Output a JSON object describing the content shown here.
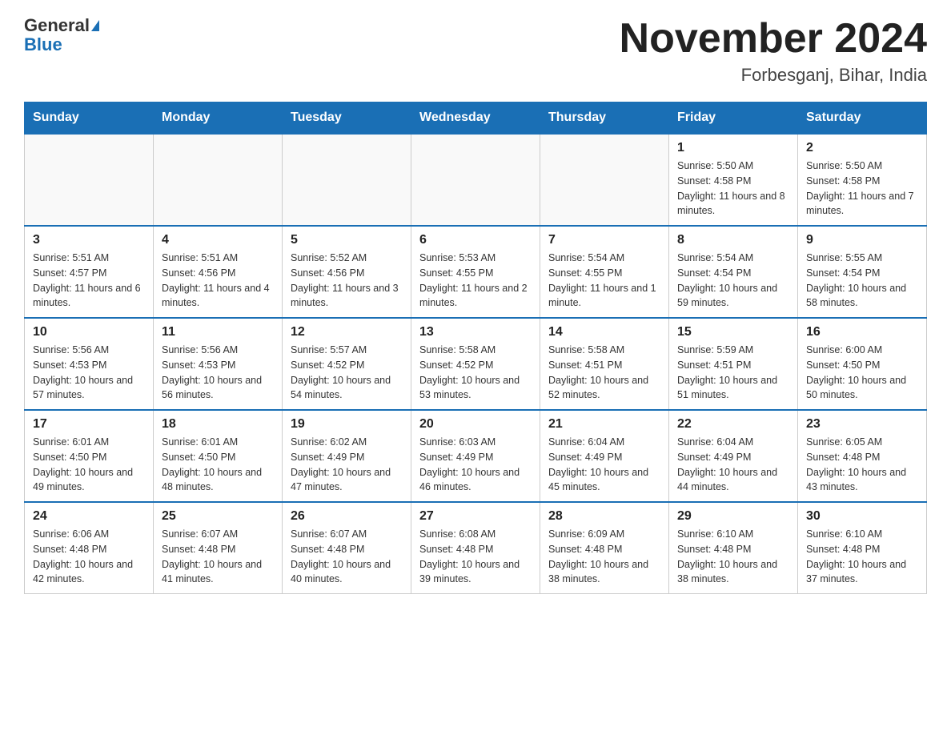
{
  "header": {
    "logo_general": "General",
    "logo_blue": "Blue",
    "month_title": "November 2024",
    "location": "Forbesganj, Bihar, India"
  },
  "days_of_week": [
    "Sunday",
    "Monday",
    "Tuesday",
    "Wednesday",
    "Thursday",
    "Friday",
    "Saturday"
  ],
  "weeks": [
    [
      {
        "day": "",
        "info": ""
      },
      {
        "day": "",
        "info": ""
      },
      {
        "day": "",
        "info": ""
      },
      {
        "day": "",
        "info": ""
      },
      {
        "day": "",
        "info": ""
      },
      {
        "day": "1",
        "info": "Sunrise: 5:50 AM\nSunset: 4:58 PM\nDaylight: 11 hours and 8 minutes."
      },
      {
        "day": "2",
        "info": "Sunrise: 5:50 AM\nSunset: 4:58 PM\nDaylight: 11 hours and 7 minutes."
      }
    ],
    [
      {
        "day": "3",
        "info": "Sunrise: 5:51 AM\nSunset: 4:57 PM\nDaylight: 11 hours and 6 minutes."
      },
      {
        "day": "4",
        "info": "Sunrise: 5:51 AM\nSunset: 4:56 PM\nDaylight: 11 hours and 4 minutes."
      },
      {
        "day": "5",
        "info": "Sunrise: 5:52 AM\nSunset: 4:56 PM\nDaylight: 11 hours and 3 minutes."
      },
      {
        "day": "6",
        "info": "Sunrise: 5:53 AM\nSunset: 4:55 PM\nDaylight: 11 hours and 2 minutes."
      },
      {
        "day": "7",
        "info": "Sunrise: 5:54 AM\nSunset: 4:55 PM\nDaylight: 11 hours and 1 minute."
      },
      {
        "day": "8",
        "info": "Sunrise: 5:54 AM\nSunset: 4:54 PM\nDaylight: 10 hours and 59 minutes."
      },
      {
        "day": "9",
        "info": "Sunrise: 5:55 AM\nSunset: 4:54 PM\nDaylight: 10 hours and 58 minutes."
      }
    ],
    [
      {
        "day": "10",
        "info": "Sunrise: 5:56 AM\nSunset: 4:53 PM\nDaylight: 10 hours and 57 minutes."
      },
      {
        "day": "11",
        "info": "Sunrise: 5:56 AM\nSunset: 4:53 PM\nDaylight: 10 hours and 56 minutes."
      },
      {
        "day": "12",
        "info": "Sunrise: 5:57 AM\nSunset: 4:52 PM\nDaylight: 10 hours and 54 minutes."
      },
      {
        "day": "13",
        "info": "Sunrise: 5:58 AM\nSunset: 4:52 PM\nDaylight: 10 hours and 53 minutes."
      },
      {
        "day": "14",
        "info": "Sunrise: 5:58 AM\nSunset: 4:51 PM\nDaylight: 10 hours and 52 minutes."
      },
      {
        "day": "15",
        "info": "Sunrise: 5:59 AM\nSunset: 4:51 PM\nDaylight: 10 hours and 51 minutes."
      },
      {
        "day": "16",
        "info": "Sunrise: 6:00 AM\nSunset: 4:50 PM\nDaylight: 10 hours and 50 minutes."
      }
    ],
    [
      {
        "day": "17",
        "info": "Sunrise: 6:01 AM\nSunset: 4:50 PM\nDaylight: 10 hours and 49 minutes."
      },
      {
        "day": "18",
        "info": "Sunrise: 6:01 AM\nSunset: 4:50 PM\nDaylight: 10 hours and 48 minutes."
      },
      {
        "day": "19",
        "info": "Sunrise: 6:02 AM\nSunset: 4:49 PM\nDaylight: 10 hours and 47 minutes."
      },
      {
        "day": "20",
        "info": "Sunrise: 6:03 AM\nSunset: 4:49 PM\nDaylight: 10 hours and 46 minutes."
      },
      {
        "day": "21",
        "info": "Sunrise: 6:04 AM\nSunset: 4:49 PM\nDaylight: 10 hours and 45 minutes."
      },
      {
        "day": "22",
        "info": "Sunrise: 6:04 AM\nSunset: 4:49 PM\nDaylight: 10 hours and 44 minutes."
      },
      {
        "day": "23",
        "info": "Sunrise: 6:05 AM\nSunset: 4:48 PM\nDaylight: 10 hours and 43 minutes."
      }
    ],
    [
      {
        "day": "24",
        "info": "Sunrise: 6:06 AM\nSunset: 4:48 PM\nDaylight: 10 hours and 42 minutes."
      },
      {
        "day": "25",
        "info": "Sunrise: 6:07 AM\nSunset: 4:48 PM\nDaylight: 10 hours and 41 minutes."
      },
      {
        "day": "26",
        "info": "Sunrise: 6:07 AM\nSunset: 4:48 PM\nDaylight: 10 hours and 40 minutes."
      },
      {
        "day": "27",
        "info": "Sunrise: 6:08 AM\nSunset: 4:48 PM\nDaylight: 10 hours and 39 minutes."
      },
      {
        "day": "28",
        "info": "Sunrise: 6:09 AM\nSunset: 4:48 PM\nDaylight: 10 hours and 38 minutes."
      },
      {
        "day": "29",
        "info": "Sunrise: 6:10 AM\nSunset: 4:48 PM\nDaylight: 10 hours and 38 minutes."
      },
      {
        "day": "30",
        "info": "Sunrise: 6:10 AM\nSunset: 4:48 PM\nDaylight: 10 hours and 37 minutes."
      }
    ]
  ]
}
